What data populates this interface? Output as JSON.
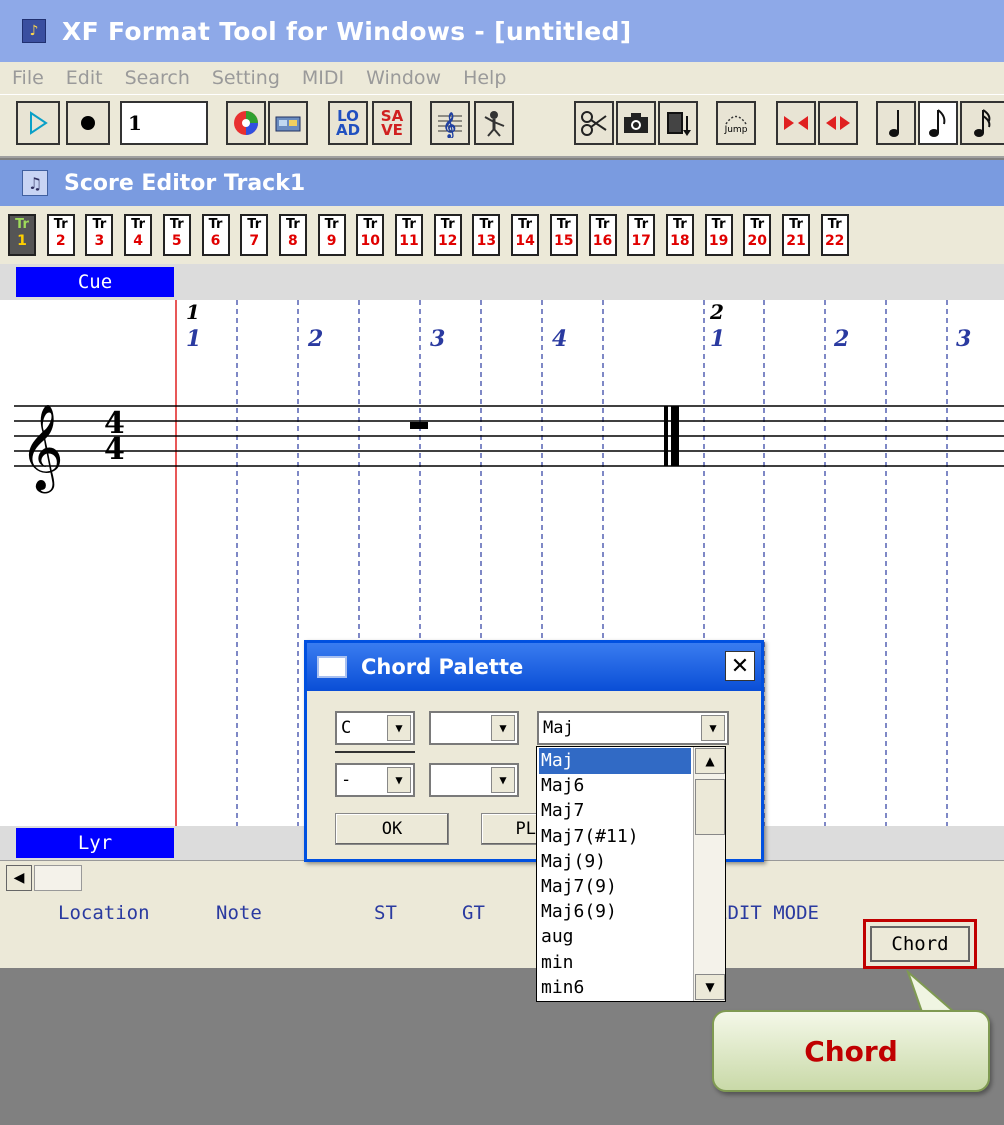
{
  "app": {
    "title": "XF Format Tool for Windows - [untitled]"
  },
  "menu": [
    "File",
    "Edit",
    "Search",
    "Setting",
    "MIDI",
    "Window",
    "Help"
  ],
  "toolbar": {
    "position_value": "1",
    "load_label": "LO\nAD",
    "save_label": "SA\nVE",
    "jump_label": "Jump"
  },
  "editor": {
    "title": "Score Editor Track1"
  },
  "tracks": [
    {
      "tr": "Tr",
      "num": "1"
    },
    {
      "tr": "Tr",
      "num": "2"
    },
    {
      "tr": "Tr",
      "num": "3"
    },
    {
      "tr": "Tr",
      "num": "4"
    },
    {
      "tr": "Tr",
      "num": "5"
    },
    {
      "tr": "Tr",
      "num": "6"
    },
    {
      "tr": "Tr",
      "num": "7"
    },
    {
      "tr": "Tr",
      "num": "8"
    },
    {
      "tr": "Tr",
      "num": "9"
    },
    {
      "tr": "Tr",
      "num": "10"
    },
    {
      "tr": "Tr",
      "num": "11"
    },
    {
      "tr": "Tr",
      "num": "12"
    },
    {
      "tr": "Tr",
      "num": "13"
    },
    {
      "tr": "Tr",
      "num": "14"
    },
    {
      "tr": "Tr",
      "num": "15"
    },
    {
      "tr": "Tr",
      "num": "16"
    },
    {
      "tr": "Tr",
      "num": "17"
    },
    {
      "tr": "Tr",
      "num": "18"
    },
    {
      "tr": "Tr",
      "num": "19"
    },
    {
      "tr": "Tr",
      "num": "20"
    },
    {
      "tr": "Tr",
      "num": "21"
    },
    {
      "tr": "Tr",
      "num": "22"
    }
  ],
  "score": {
    "cue_label": "Cue",
    "lyr_label": "Lyr",
    "time_sig_top": "4",
    "time_sig_bottom": "4",
    "bar1": "1",
    "bar2": "2",
    "beats": [
      "1",
      "2",
      "3",
      "4",
      "1",
      "2",
      "3"
    ]
  },
  "status": {
    "location": "Location",
    "note": "Note",
    "st": "ST",
    "gt": "GT",
    "edit_mode": "EDIT MODE",
    "mode_button": "Chord"
  },
  "callout": {
    "text": "Chord"
  },
  "dialog": {
    "title": "Chord Palette",
    "root_value": "C",
    "root2_value": "",
    "bass_value": "-",
    "bass2_value": "",
    "type_value": "Maj",
    "ok_label": "OK",
    "play_label": "PL"
  },
  "chord_types": [
    "Maj",
    "Maj6",
    "Maj7",
    "Maj7(#11)",
    "Maj(9)",
    "Maj7(9)",
    "Maj6(9)",
    "aug",
    "min",
    "min6"
  ],
  "colors": {
    "title_bar": "#8ea9e8",
    "editor_title": "#7a9be0",
    "label_blue": "#0000ff",
    "selection": "#316ac5",
    "callout_text": "#c00000"
  }
}
